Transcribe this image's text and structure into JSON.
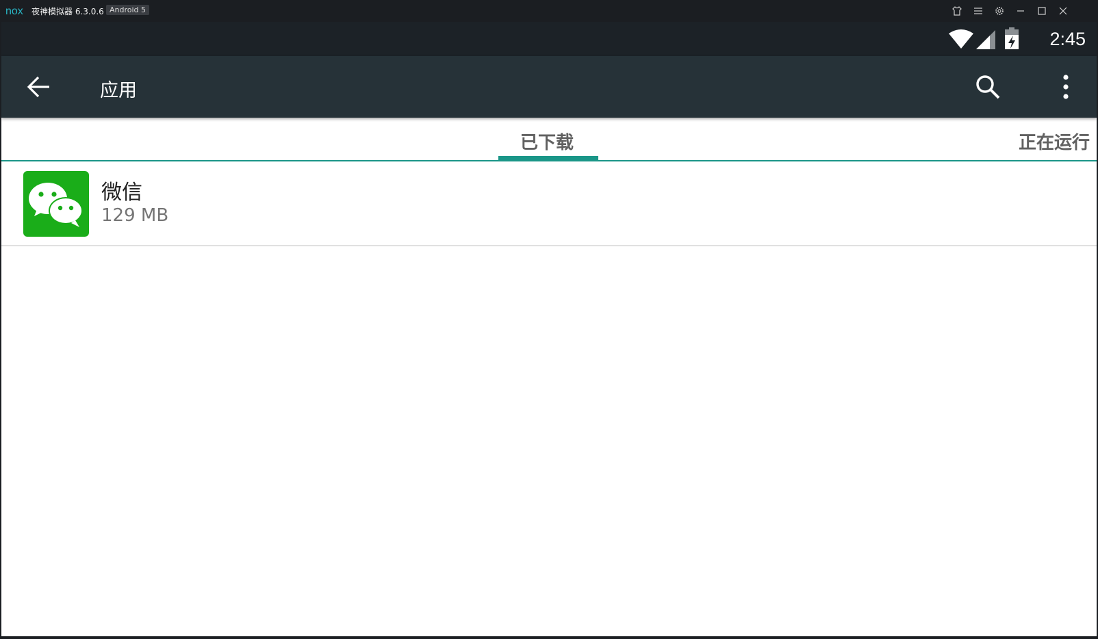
{
  "window": {
    "logo_text": "nox",
    "title": "夜神模拟器 6.3.0.6",
    "android_badge": "Android 5",
    "controls": [
      "shirt-icon",
      "menu-icon",
      "gear-icon",
      "minimize-icon",
      "maximize-icon",
      "close-icon"
    ]
  },
  "status_bar": {
    "time": "2:45",
    "icons": [
      "wifi-icon",
      "signal-icon",
      "battery-charging-icon"
    ]
  },
  "app_bar": {
    "title": "应用",
    "icons": [
      "back-arrow-icon",
      "search-icon",
      "more-vert-icon"
    ]
  },
  "tabs": [
    {
      "label": "已下载",
      "selected": true
    },
    {
      "label": "正在运行",
      "selected": false
    }
  ],
  "apps": [
    {
      "name": "微信",
      "size": "129 MB",
      "icon": "wechat-icon"
    }
  ],
  "colors": {
    "status_bar": "#1c2227",
    "app_bar": "#263238",
    "accent": "#1a9688",
    "wechat_green": "#1aad19"
  }
}
